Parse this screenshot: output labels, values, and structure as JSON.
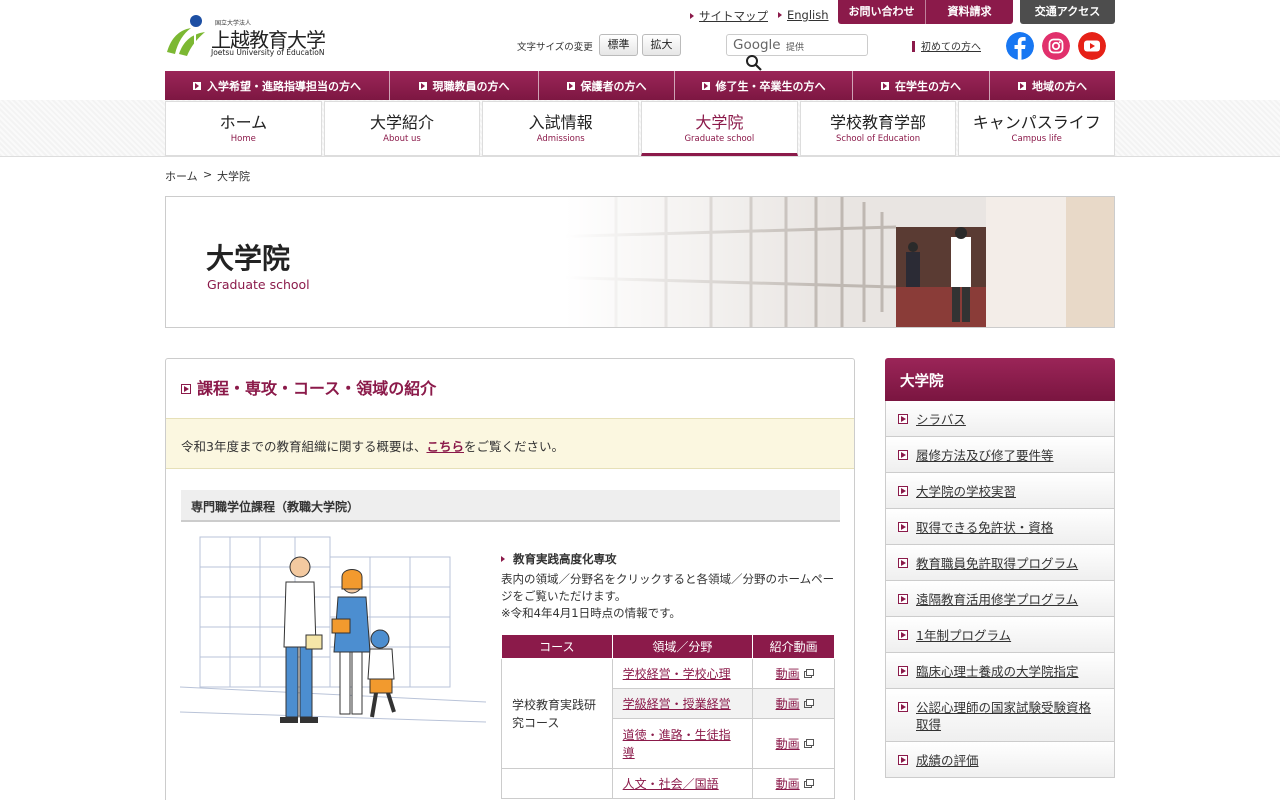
{
  "brand": {
    "small": "国立大学法人",
    "name": "上越教育大学",
    "en": "Joetsu University of EducatioN"
  },
  "utility": {
    "sitemap": "サイトマップ",
    "english": "English",
    "contact": "お問い合わせ",
    "request": "資料請求",
    "access": "交通アクセス",
    "fontsize_label": "文字サイズの変更",
    "fs_standard": "標準",
    "fs_large": "拡大",
    "search_brand": "Google",
    "search_text": "提供",
    "first_visit": "初めての方へ"
  },
  "audience_nav": [
    "入学希望・進路指導担当の方へ",
    "現職教員の方へ",
    "保護者の方へ",
    "修了生・卒業生の方へ",
    "在学生の方へ",
    "地域の方へ"
  ],
  "main_nav": [
    {
      "ja": "ホーム",
      "en": "Home"
    },
    {
      "ja": "大学紹介",
      "en": "About us"
    },
    {
      "ja": "入試情報",
      "en": "Admissions"
    },
    {
      "ja": "大学院",
      "en": "Graduate school"
    },
    {
      "ja": "学校教育学部",
      "en": "School of Education"
    },
    {
      "ja": "キャンパスライフ",
      "en": "Campus life"
    }
  ],
  "breadcrumb": {
    "home": "ホーム",
    "sep": ">",
    "current": "大学院"
  },
  "hero": {
    "title": "大学院",
    "subtitle": "Graduate school"
  },
  "content": {
    "heading": "課程・専攻・コース・領域の紹介",
    "notice_before": "令和3年度までの教育組織に関する概要は、",
    "notice_link": "こちら",
    "notice_after": "をご覧ください。",
    "section": "専門職学位課程（教職大学院）",
    "major": "教育実践高度化専攻",
    "desc1": "表内の領域／分野名をクリックすると各領域／分野のホームページをご覧いただけます。",
    "desc2": "※令和4年4月1日時点の情報です。",
    "table": {
      "headers": [
        "コース",
        "領域／分野",
        "紹介動画"
      ],
      "course1": "学校教育実践研究コース",
      "rows": [
        {
          "field": "学校経営・学校心理",
          "video": "動画"
        },
        {
          "field": "学級経営・授業経営",
          "video": "動画"
        },
        {
          "field": "道徳・進路・生徒指導",
          "video": "動画"
        },
        {
          "field": "人文・社会／国語",
          "video": "動画"
        }
      ]
    }
  },
  "sidebar": {
    "title": "大学院",
    "items": [
      "シラバス",
      "履修方法及び修了要件等",
      "大学院の学校実習",
      "取得できる免許状・資格",
      "教育職員免許取得プログラム",
      "遠隔教育活用修学プログラム",
      "1年制プログラム",
      "臨床心理士養成の大学院指定",
      "公認心理師の国家試験受験資格取得",
      "成績の評価"
    ]
  },
  "colors": {
    "accent": "#8b1a4a",
    "notice_bg": "#fbf7e0",
    "facebook": "#1877f2",
    "instagram": "#e1306c",
    "youtube": "#e62117"
  }
}
